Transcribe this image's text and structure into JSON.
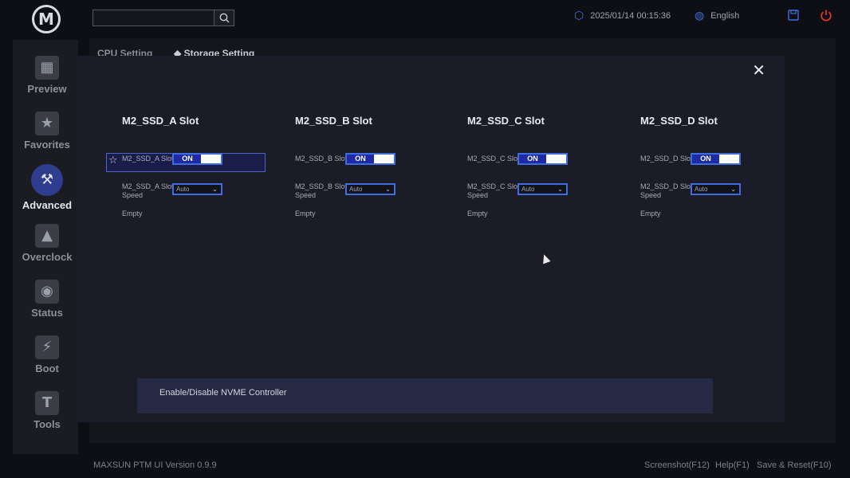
{
  "topbar": {
    "search_placeholder": "",
    "datetime": "2025/01/14 00:15:36",
    "language": "English"
  },
  "sidebar": {
    "logo": "M",
    "items": [
      {
        "label": "Preview",
        "icon": "grid-icon"
      },
      {
        "label": "Favorites",
        "icon": "star-icon"
      },
      {
        "label": "Advanced",
        "icon": "tools-icon"
      },
      {
        "label": "Overclock",
        "icon": "rocket-icon"
      },
      {
        "label": "Status",
        "icon": "gauge-icon"
      },
      {
        "label": "Boot",
        "icon": "boot-drive-icon"
      },
      {
        "label": "Tools",
        "icon": "hammer-icon"
      }
    ]
  },
  "bg_tabs": {
    "left": "CPU Setting",
    "right": "Storage Setting"
  },
  "modal": {
    "columns": [
      {
        "title": "M2_SSD_A Slot",
        "slot_label": "M2_SSD_A Slot",
        "slot_value": "ON",
        "speed_label": "M2_SSD_A Slot Speed",
        "speed_value": "Auto",
        "status": "Empty"
      },
      {
        "title": "M2_SSD_B Slot",
        "slot_label": "M2_SSD_B Slot",
        "slot_value": "ON",
        "speed_label": "M2_SSD_B Slot Speed",
        "speed_value": "Auto",
        "status": "Empty"
      },
      {
        "title": "M2_SSD_C Slot",
        "slot_label": "M2_SSD_C Slot",
        "slot_value": "ON",
        "speed_label": "M2_SSD_C Slot Speed",
        "speed_value": "Auto",
        "status": "Empty"
      },
      {
        "title": "M2_SSD_D Slot",
        "slot_label": "M2_SSD_D Slot",
        "slot_value": "ON",
        "speed_label": "M2_SSD_D Slot Speed",
        "speed_value": "Auto",
        "status": "Empty"
      }
    ],
    "help_text": "Enable/Disable NVME Controller"
  },
  "footer": {
    "version": "MAXSUN PTM UI Version 0.9.9",
    "screenshot": "Screenshot(F12)",
    "help": "Help(F1)",
    "save_reset": "Save & Reset(F10)"
  },
  "colors": {
    "accent": "#3f6de0",
    "toggle_on": "#1f2aa5",
    "power": "#e0342f"
  }
}
